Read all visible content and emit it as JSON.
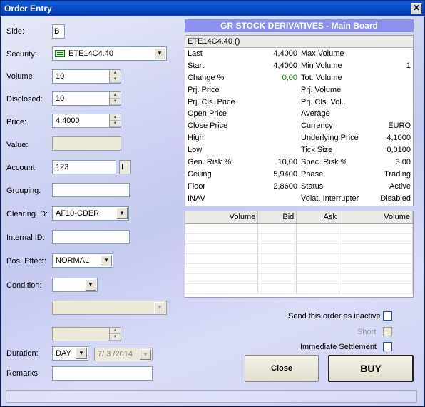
{
  "window": {
    "title": "Order Entry",
    "close_glyph": "✕"
  },
  "form": {
    "side": {
      "label": "Side:",
      "value": "B"
    },
    "security": {
      "label": "Security:",
      "value": "ETE14C4.40",
      "icon": "security-card-icon"
    },
    "volume": {
      "label": "Volume:",
      "value": "10"
    },
    "disclosed": {
      "label": "Disclosed:",
      "value": "10"
    },
    "price": {
      "label": "Price:",
      "value": "4,4000"
    },
    "value": {
      "label": "Value:",
      "value": ""
    },
    "account": {
      "label": "Account:",
      "value": "123",
      "indicator": "I"
    },
    "grouping": {
      "label": "Grouping:",
      "value": ""
    },
    "clearing_id": {
      "label": "Clearing ID:",
      "value": "AF10-CDER"
    },
    "internal_id": {
      "label": "Internal ID:",
      "value": ""
    },
    "pos_effect": {
      "label": "Pos. Effect:",
      "value": "NORMAL"
    },
    "condition": {
      "label": "Condition:",
      "value": ""
    },
    "extra_combo": {
      "value": ""
    },
    "extra_spin": {
      "value": ""
    },
    "duration": {
      "label": "Duration:",
      "value": "DAY",
      "date": "7/ 3 /2014"
    },
    "remarks": {
      "label": "Remarks:",
      "value": ""
    }
  },
  "board": {
    "title": "GR STOCK DERIVATIVES - Main Board",
    "instrument": "ETE14C4.40 ()",
    "rows": [
      {
        "l_label": "Last",
        "l_value": "4,4000",
        "r_label": "Max Volume",
        "r_value": ""
      },
      {
        "l_label": "Start",
        "l_value": "4,4000",
        "r_label": "Min Volume",
        "r_value": "1"
      },
      {
        "l_label": "Change %",
        "l_value": "0,00",
        "r_label": "Tot. Volume",
        "r_value": ""
      },
      {
        "l_label": "Prj. Price",
        "l_value": "",
        "r_label": "Prj. Volume",
        "r_value": ""
      },
      {
        "l_label": "Prj. Cls. Price",
        "l_value": "",
        "r_label": "Prj. Cls. Vol.",
        "r_value": ""
      },
      {
        "l_label": "Open Price",
        "l_value": "",
        "r_label": "Average",
        "r_value": ""
      },
      {
        "l_label": "Close Price",
        "l_value": "",
        "r_label": "Currency",
        "r_value": "EURO"
      },
      {
        "l_label": "High",
        "l_value": "",
        "r_label": "Underlying Price",
        "r_value": "4,1000"
      },
      {
        "l_label": "Low",
        "l_value": "",
        "r_label": "Tick Size",
        "r_value": "0,0100"
      },
      {
        "l_label": "Gen. Risk %",
        "l_value": "10,00",
        "r_label": "Spec. Risk %",
        "r_value": "3,00"
      },
      {
        "l_label": "Ceiling",
        "l_value": "5,9400",
        "r_label": "Phase",
        "r_value": "Trading"
      },
      {
        "l_label": "Floor",
        "l_value": "2,8600",
        "r_label": "Status",
        "r_value": "Active"
      },
      {
        "l_label": "INAV",
        "l_value": "",
        "r_label": "Volat. Interrupter",
        "r_value": "Disabled"
      }
    ],
    "change_color": "#008000"
  },
  "depth": {
    "columns": [
      "Volume",
      "Bid",
      "Ask",
      "Volume"
    ]
  },
  "options": {
    "inactive": "Send this order as inactive",
    "short": "Short",
    "immediate": "Immediate Settlement"
  },
  "buttons": {
    "close": "Close",
    "buy": "BUY"
  },
  "colors": {
    "title_bar": "#0a4cc8",
    "board_header": "#8d90ec"
  }
}
